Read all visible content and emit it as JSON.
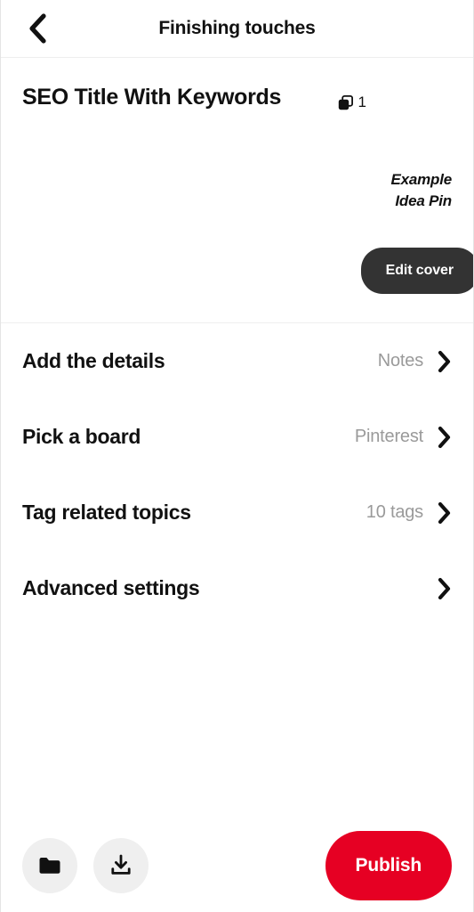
{
  "header": {
    "back_icon": "chevron-left-icon",
    "title": "Finishing touches"
  },
  "cover": {
    "pin_title": "SEO Title With Keywords",
    "pages_icon": "stacked-pages-icon",
    "page_count": "1",
    "cover_label_line1": "Example",
    "cover_label_line2": "Idea Pin",
    "edit_cover_label": "Edit cover"
  },
  "settings": {
    "rows": [
      {
        "label": "Add the details",
        "value": "Notes",
        "chevron": "chevron-right-icon"
      },
      {
        "label": "Pick a board",
        "value": "Pinterest",
        "chevron": "chevron-right-icon"
      },
      {
        "label": "Tag related topics",
        "value": "10 tags",
        "chevron": "chevron-right-icon"
      },
      {
        "label": "Advanced settings",
        "value": "",
        "chevron": "chevron-right-icon"
      }
    ]
  },
  "bottom_bar": {
    "folder_icon": "folder-icon",
    "download_icon": "download-icon",
    "publish_label": "Publish"
  },
  "colors": {
    "brand_red": "#e60023",
    "dark_button": "#333333",
    "muted_text": "#9a9a9a",
    "icon_circle_bg": "#efefef",
    "divider": "#eeeeee"
  }
}
